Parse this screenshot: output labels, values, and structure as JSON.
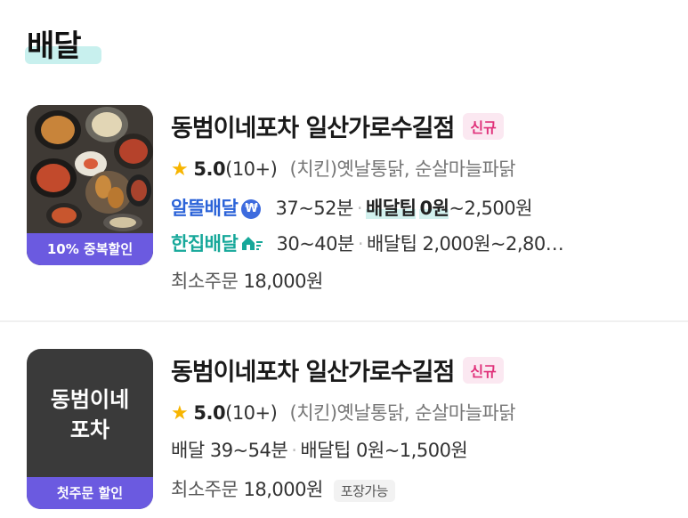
{
  "section": {
    "title": "배달"
  },
  "stores": [
    {
      "name": "동범이네포차 일산가로수길점",
      "badge": "신규",
      "rating": "5.0",
      "rating_count": "(10+)",
      "category": "(치킨)옛날통닭, 순살마늘파닭",
      "thumb_banner": "10% 중복할인",
      "delivery": [
        {
          "service": "알뜰배달",
          "icon": "won-icon",
          "time": "37~52분",
          "tip_label": "배달팁",
          "tip_highlight": "0원",
          "tip_rest": "~2,500원"
        },
        {
          "service": "한집배달",
          "icon": "home-icon",
          "time": "30~40분",
          "tip_label": "배달팁",
          "tip_text": "2,000원~2,80…"
        }
      ],
      "min_order_label": "최소주문",
      "min_order_value": "18,000원"
    },
    {
      "name": "동범이네포차 일산가로수길점",
      "badge": "신규",
      "rating": "5.0",
      "rating_count": "(10+)",
      "category": "(치킨)옛날통닭, 순살마늘파닭",
      "thumb_name": "동범이네\n포차",
      "thumb_banner": "첫주문 할인",
      "delivery_label": "배달",
      "delivery_time": "39~54분",
      "tip_label": "배달팁",
      "tip_text": "0원~1,500원",
      "min_order_label": "최소주문",
      "min_order_value": "18,000원",
      "pack_badge": "포장가능"
    }
  ],
  "colors": {
    "accent_purple": "#6b5ae0",
    "new_badge": "#e0317a",
    "save_blue": "#2b63d8",
    "home_teal": "#17a89a",
    "star": "#f7b500"
  }
}
